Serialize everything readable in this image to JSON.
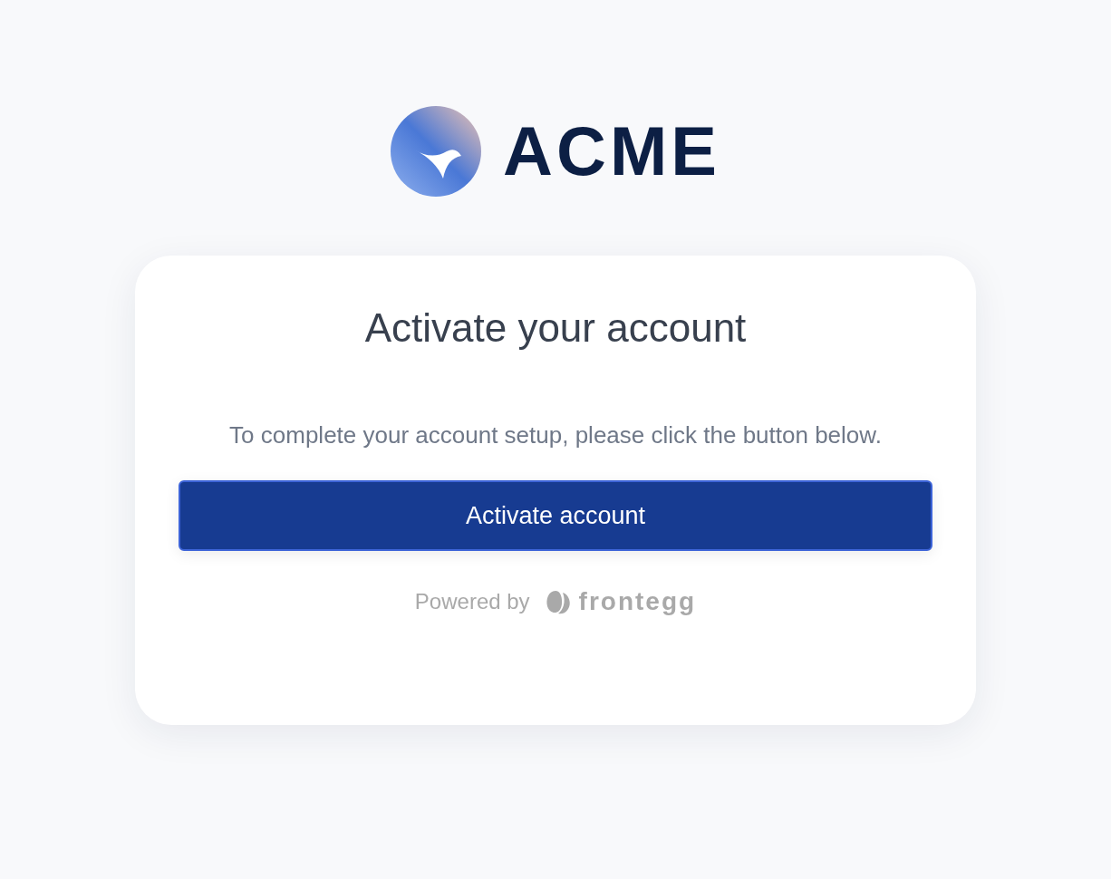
{
  "logo": {
    "text": "ACME"
  },
  "card": {
    "title": "Activate your account",
    "description": "To complete your account setup, please click the button below.",
    "button": "Activate account",
    "footer": {
      "powered_by": "Powered by",
      "brand": "frontegg"
    }
  }
}
